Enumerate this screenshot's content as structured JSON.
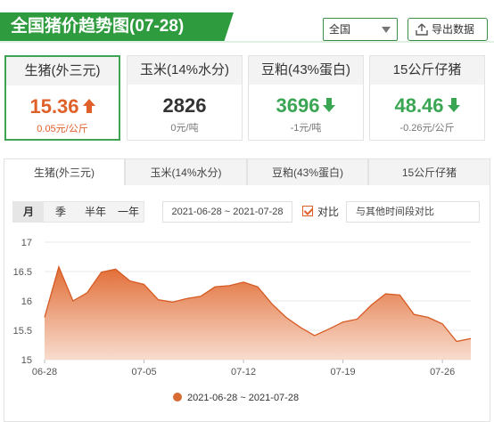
{
  "header": {
    "title": "全国猪价趋势图(07-28)"
  },
  "region_select": {
    "value": "全国",
    "icon": "caret-down-icon"
  },
  "export_button": {
    "label": "导出数据",
    "icon": "upload-icon"
  },
  "cards": [
    {
      "name": "生猪(外三元)",
      "value": "15.36",
      "change": "0.05元/公斤",
      "trend": "up",
      "active": true
    },
    {
      "name": "玉米(14%水分)",
      "value": "2826",
      "change": "0元/吨",
      "trend": "flat",
      "active": false
    },
    {
      "name": "豆粕(43%蛋白)",
      "value": "3696",
      "change": "-1元/吨",
      "trend": "down",
      "active": false
    },
    {
      "name": "15公斤仔猪",
      "value": "48.46",
      "change": "-0.26元/公斤",
      "trend": "down",
      "active": false
    }
  ],
  "tabs": [
    "生猪(外三元)",
    "玉米(14%水分)",
    "豆粕(43%蛋白)",
    "15公斤仔猪"
  ],
  "periods": [
    "月",
    "季",
    "半年",
    "一年"
  ],
  "date_range": "2021-06-28 ~ 2021-07-28",
  "compare": {
    "label": "对比",
    "checked": true,
    "placeholder": "与其他时间段对比"
  },
  "colors": {
    "brand_green": "#2e9b3e",
    "up": "#e0602a",
    "down": "#3aa653",
    "series": "#d86a34"
  },
  "chart_data": {
    "type": "area",
    "title": "",
    "x": [
      "06-28",
      "06-29",
      "06-30",
      "07-01",
      "07-02",
      "07-03",
      "07-04",
      "07-05",
      "07-06",
      "07-07",
      "07-08",
      "07-09",
      "07-10",
      "07-11",
      "07-12",
      "07-13",
      "07-14",
      "07-15",
      "07-16",
      "07-17",
      "07-18",
      "07-19",
      "07-20",
      "07-21",
      "07-22",
      "07-23",
      "07-24",
      "07-25",
      "07-26",
      "07-27",
      "07-28"
    ],
    "x_tick_labels": [
      "06-28",
      "07-05",
      "07-12",
      "07-19",
      "07-26"
    ],
    "series": [
      {
        "name": "2021-06-28 ~ 2021-07-28",
        "values": [
          15.72,
          16.58,
          16.0,
          16.14,
          16.49,
          16.54,
          16.34,
          16.28,
          16.02,
          15.98,
          16.04,
          16.08,
          16.24,
          16.26,
          16.32,
          16.24,
          15.95,
          15.72,
          15.55,
          15.41,
          15.52,
          15.64,
          15.69,
          15.93,
          16.12,
          16.1,
          15.77,
          15.72,
          15.61,
          15.31,
          15.36
        ]
      }
    ],
    "ylim": [
      15,
      17
    ],
    "y_ticks": [
      "15",
      "15.5",
      "16",
      "16.5",
      "17"
    ],
    "grid": true,
    "legend": "bottom-center"
  }
}
